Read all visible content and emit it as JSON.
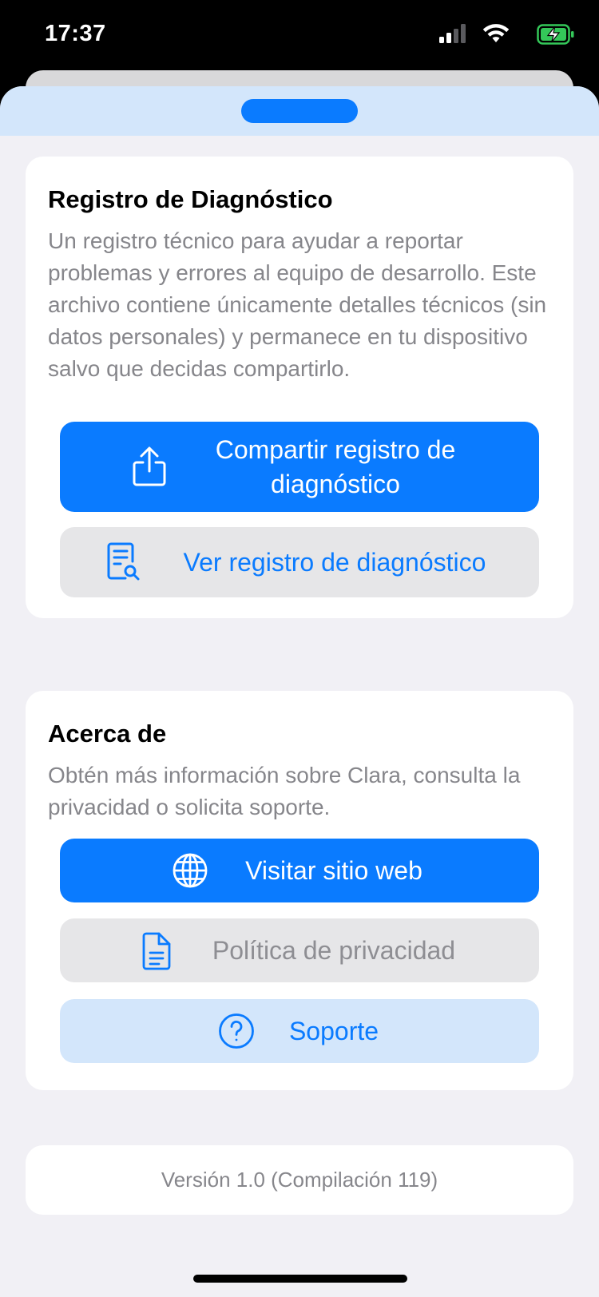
{
  "status_bar": {
    "time": "17:37",
    "icons": [
      "cellular-signal-icon",
      "wifi-icon",
      "battery-charging-icon"
    ]
  },
  "diagnostics": {
    "title": "Registro de Diagnóstico",
    "description": "Un registro técnico para ayudar a reportar problemas y errores al equipo de desarrollo. Este archivo contiene únicamente detalles técnicos (sin datos personales) y permanece en tu dispositivo salvo que decidas compartirlo.",
    "share_button": {
      "label": "Compartir registro de diagnóstico",
      "icon": "share-icon"
    },
    "view_button": {
      "label": "Ver registro de diagnóstico",
      "icon": "document-search-icon"
    }
  },
  "about": {
    "title": "Acerca de",
    "description": "Obtén más información sobre Clara, consulta la privacidad o solicita soporte.",
    "website_button": {
      "label": "Visitar sitio web",
      "icon": "globe-icon"
    },
    "privacy_button": {
      "label": "Política de privacidad",
      "icon": "document-icon"
    },
    "support_button": {
      "label": "Soporte",
      "icon": "question-circle-icon"
    }
  },
  "version_text": "Versión 1.0 (Compilación 119)",
  "colors": {
    "accent": "#0a7bff",
    "light_accent": "#d3e6fb",
    "secondary_text": "#86868b",
    "background": "#f1f0f5"
  }
}
